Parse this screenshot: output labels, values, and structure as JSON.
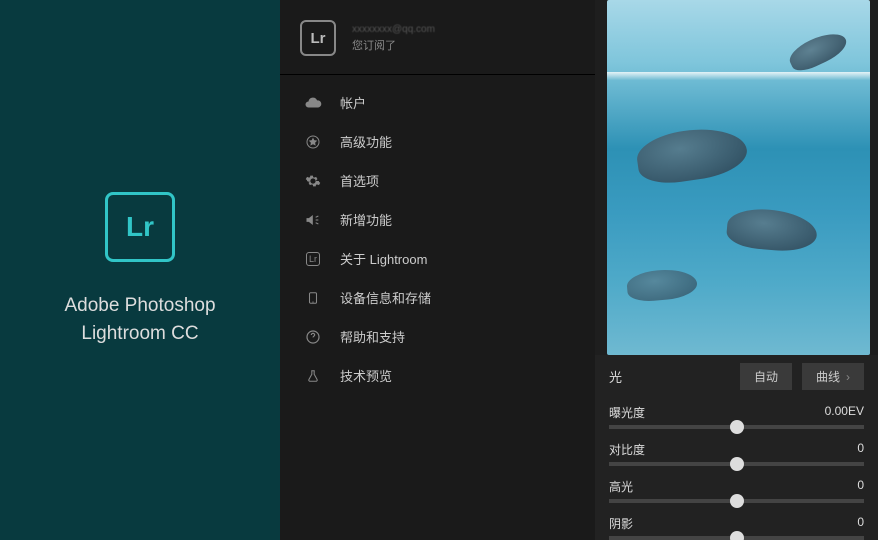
{
  "brand": {
    "logo": "Lr",
    "title_line1": "Adobe Photoshop",
    "title_line2": "Lightroom CC"
  },
  "menu": {
    "logo": "Lr",
    "email": "xxxxxxxx@qq.com",
    "sub": "您订阅了",
    "items": [
      {
        "icon": "cloud",
        "label": "帐户"
      },
      {
        "icon": "star",
        "label": "高级功能"
      },
      {
        "icon": "gear",
        "label": "首选项"
      },
      {
        "icon": "megaphone",
        "label": "新增功能"
      },
      {
        "icon": "lr",
        "label": "关于 Lightroom"
      },
      {
        "icon": "device",
        "label": "设备信息和存储"
      },
      {
        "icon": "help",
        "label": "帮助和支持"
      },
      {
        "icon": "flask",
        "label": "技术预览"
      }
    ]
  },
  "adjust": {
    "section": "光",
    "auto": "自动",
    "curves": "曲线",
    "sliders": [
      {
        "name": "曝光度",
        "value": "0.00EV",
        "pos": 50
      },
      {
        "name": "对比度",
        "value": "0",
        "pos": 50
      },
      {
        "name": "高光",
        "value": "0",
        "pos": 50
      },
      {
        "name": "阴影",
        "value": "0",
        "pos": 50
      }
    ]
  }
}
